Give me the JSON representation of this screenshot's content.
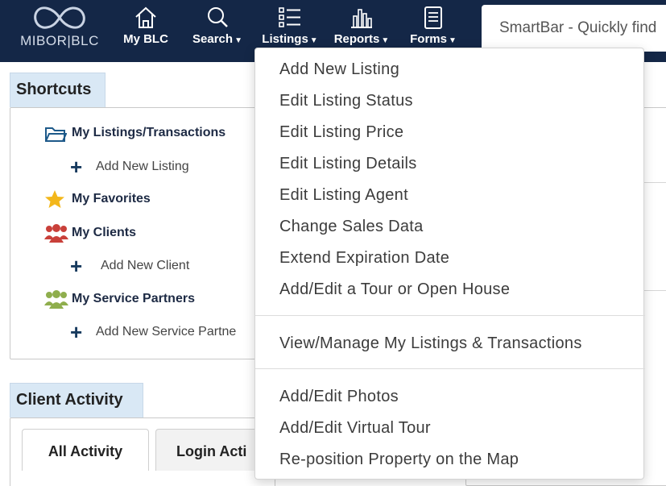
{
  "header": {
    "logo_text": "MIBOR|BLC",
    "nav": [
      {
        "label": "My BLC",
        "icon": "home-icon",
        "caret": false
      },
      {
        "label": "Search",
        "icon": "magnifier-icon",
        "caret": true
      },
      {
        "label": "Listings",
        "icon": "list-icon",
        "caret": true
      },
      {
        "label": "Reports",
        "icon": "bar-chart-icon",
        "caret": true
      },
      {
        "label": "Forms",
        "icon": "document-icon",
        "caret": true
      }
    ],
    "smartbar_placeholder": "SmartBar - Quickly find"
  },
  "shortcuts": {
    "title": "Shortcuts",
    "items": [
      {
        "label": "My Listings/Transactions",
        "icon": "folder-icon"
      },
      {
        "label": "Add New Listing",
        "icon": "plus-icon"
      },
      {
        "label": "My Favorites",
        "icon": "star-icon"
      },
      {
        "label": "My Clients",
        "icon": "people-icon"
      },
      {
        "label": "Add New Client",
        "icon": "plus-icon"
      },
      {
        "label": "My Service Partners",
        "icon": "people-icon"
      },
      {
        "label": "Add New Service Partne",
        "icon": "plus-icon"
      }
    ]
  },
  "client_activity": {
    "title": "Client Activity",
    "tabs": [
      "All Activity",
      "Login Acti"
    ]
  },
  "listings_menu": {
    "group1": [
      "Add New Listing",
      "Edit Listing Status",
      "Edit Listing Price",
      "Edit Listing Details",
      "Edit Listing Agent",
      "Change Sales Data",
      "Extend Expiration Date",
      "Add/Edit a Tour or Open House"
    ],
    "group2": [
      "View/Manage My Listings & Transactions"
    ],
    "group3": [
      "Add/Edit Photos",
      "Add/Edit Virtual Tour",
      "Re-position Property on the Map"
    ]
  },
  "colors": {
    "header_bg": "#142747",
    "tab_bg": "#d9e8f5",
    "star": "#f3b71b",
    "clients_icon": "#c9403a",
    "partners_icon": "#8fae4d"
  }
}
